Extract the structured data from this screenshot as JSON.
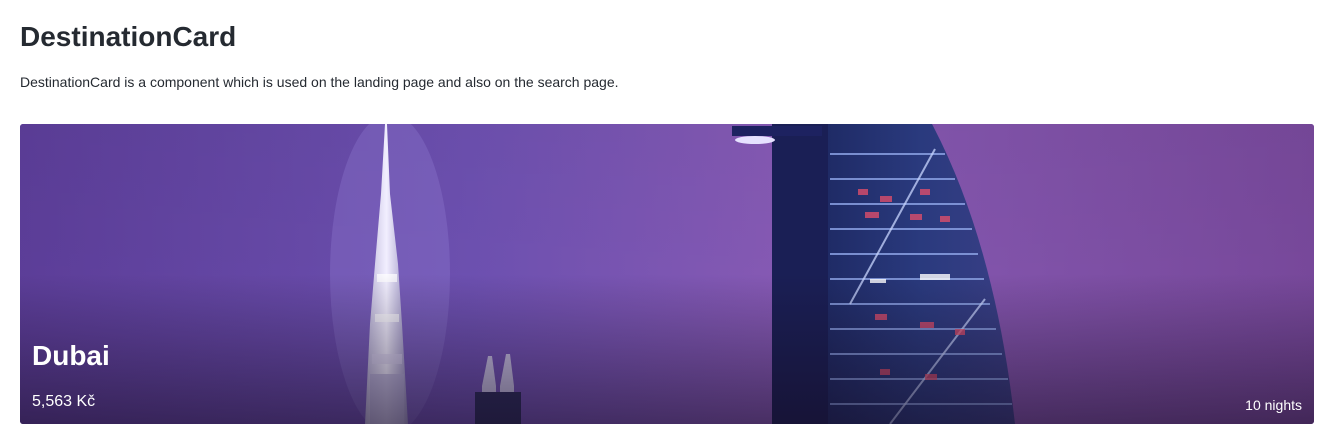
{
  "page": {
    "title": "DestinationCard",
    "description": "DestinationCard is a component which is used on the landing page and also on the search page."
  },
  "card": {
    "city": "Dubai",
    "price": "5,563 Kč",
    "duration": "10 nights",
    "image": {
      "subject": "dubai-skyline-night",
      "sky_color": "#7e52b0"
    }
  }
}
